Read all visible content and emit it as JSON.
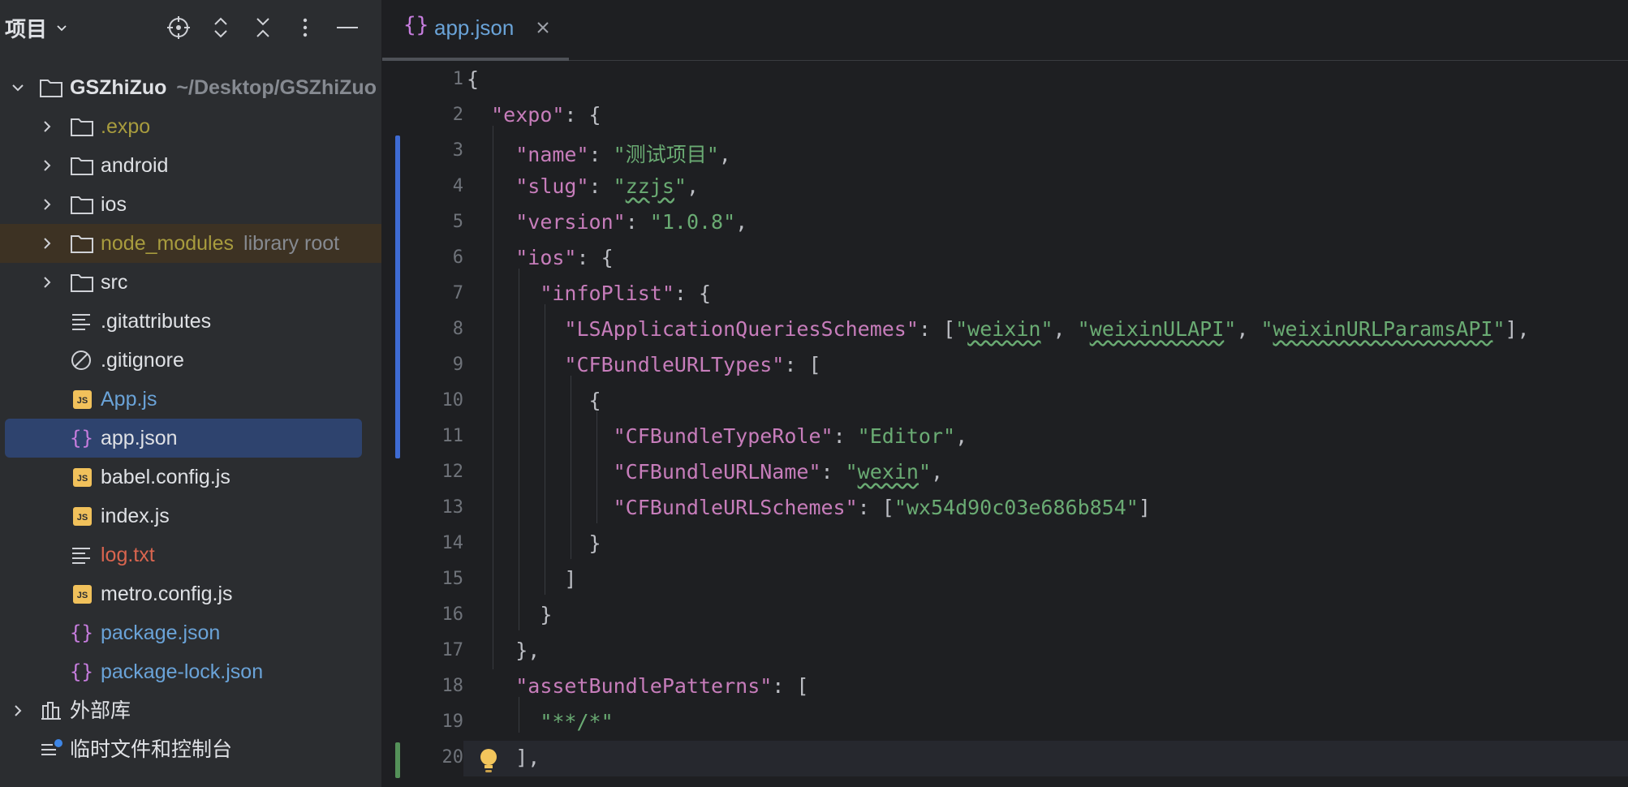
{
  "panel": {
    "title": "项目",
    "tools": [
      "locate-icon",
      "expand-all-icon",
      "collapse-all-icon",
      "more-icon",
      "minimize-icon"
    ]
  },
  "tree": {
    "root_name": "GSZhiZuo",
    "root_path": "~/Desktop/GSZhiZuo",
    "items": [
      {
        "label": ".expo",
        "color": "#a89c3e"
      },
      {
        "label": "android",
        "color": "#dfe1e5"
      },
      {
        "label": "ios",
        "color": "#dfe1e5"
      },
      {
        "label": "node_modules",
        "hint": "library root",
        "color": "#a89c3e"
      },
      {
        "label": "src",
        "color": "#dfe1e5"
      },
      {
        "label": ".gitattributes",
        "color": "#dfe1e5"
      },
      {
        "label": ".gitignore",
        "color": "#dfe1e5"
      },
      {
        "label": "App.js",
        "color": "#6aa3d8"
      },
      {
        "label": "app.json",
        "color": "#dfe1e5"
      },
      {
        "label": "babel.config.js",
        "color": "#dfe1e5"
      },
      {
        "label": "index.js",
        "color": "#dfe1e5"
      },
      {
        "label": "log.txt",
        "color": "#d9654f"
      },
      {
        "label": "metro.config.js",
        "color": "#dfe1e5"
      },
      {
        "label": "package.json",
        "color": "#6aa3d8"
      },
      {
        "label": "package-lock.json",
        "color": "#6aa3d8"
      }
    ],
    "external_libs": "外部库",
    "scratches": "临时文件和控制台"
  },
  "editor": {
    "tab_label": "app.json",
    "line_numbers": [
      "1",
      "2",
      "3",
      "4",
      "5",
      "6",
      "7",
      "8",
      "9",
      "10",
      "11",
      "12",
      "13",
      "14",
      "15",
      "16",
      "17",
      "18",
      "19",
      "20"
    ]
  },
  "code": {
    "expo_key": "\"expo\"",
    "name_key": "\"name\"",
    "name_val": "\"测试项目\"",
    "slug_key": "\"slug\"",
    "slug_val": "zzjs",
    "version_key": "\"version\"",
    "version_val": "\"1.0.8\"",
    "ios_key": "\"ios\"",
    "infoplist_key": "\"infoPlist\"",
    "lsa_key": "\"LSApplicationQueriesSchemes\"",
    "lsa_v1": "weixin",
    "lsa_v2": "weixinULAPI",
    "lsa_v3": "weixinURLParamsAPI",
    "cfb_types_key": "\"CFBundleURLTypes\"",
    "role_key": "\"CFBundleTypeRole\"",
    "role_val": "\"Editor\"",
    "urlname_key": "\"CFBundleURLName\"",
    "urlname_val": "wexin",
    "schemes_key": "\"CFBundleURLSchemes\"",
    "schemes_val": "\"wx54d90c03e686b854\"",
    "abp_key": "\"assetBundlePatterns\"",
    "abp_val": "\"**/*\""
  }
}
